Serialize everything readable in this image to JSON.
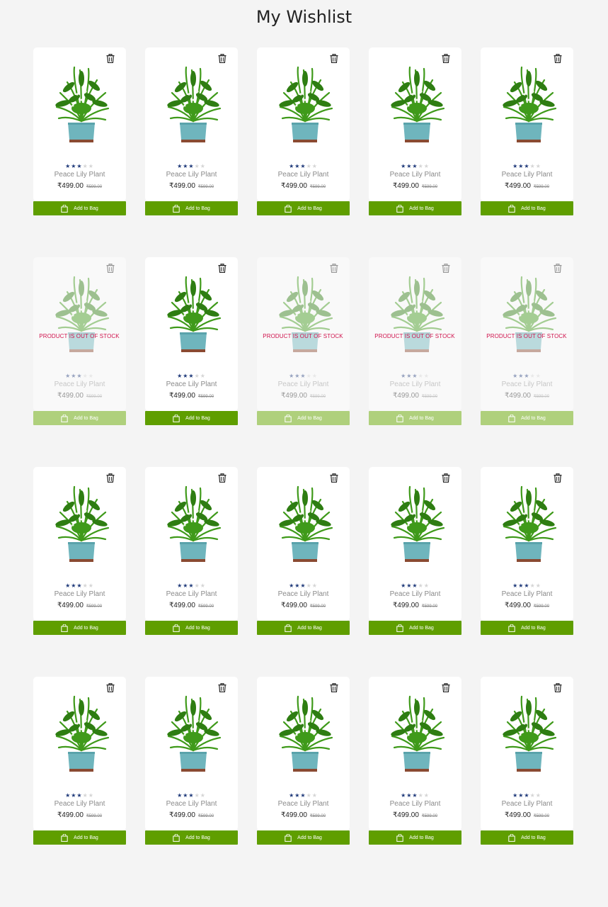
{
  "page": {
    "title": "My Wishlist"
  },
  "colors": {
    "accent": "#5f9e00",
    "accent_disabled": "#afd07c",
    "out_of_stock": "#d0134d",
    "star": "#1f3a7a"
  },
  "icons": {
    "remove": "trash-icon",
    "bag": "shopping-bag-icon",
    "rating": "star-icon"
  },
  "product_template": {
    "name": "Peace Lily Plant",
    "price": "₹499.00",
    "old_price": "₹599.00",
    "rating": 3,
    "rating_max": 5,
    "button_label": "Add to Bag",
    "out_of_stock_label": "PRODUCT IS OUT OF STOCK"
  },
  "rows": [
    {
      "items": [
        {
          "out_of_stock": false
        },
        {
          "out_of_stock": false
        },
        {
          "out_of_stock": false
        },
        {
          "out_of_stock": false
        },
        {
          "out_of_stock": false
        }
      ]
    },
    {
      "items": [
        {
          "out_of_stock": true
        },
        {
          "out_of_stock": false
        },
        {
          "out_of_stock": true
        },
        {
          "out_of_stock": true
        },
        {
          "out_of_stock": true
        }
      ]
    },
    {
      "items": [
        {
          "out_of_stock": false
        },
        {
          "out_of_stock": false
        },
        {
          "out_of_stock": false
        },
        {
          "out_of_stock": false
        },
        {
          "out_of_stock": false
        }
      ]
    },
    {
      "items": [
        {
          "out_of_stock": false
        },
        {
          "out_of_stock": false
        },
        {
          "out_of_stock": false
        },
        {
          "out_of_stock": false
        },
        {
          "out_of_stock": false
        }
      ]
    }
  ]
}
